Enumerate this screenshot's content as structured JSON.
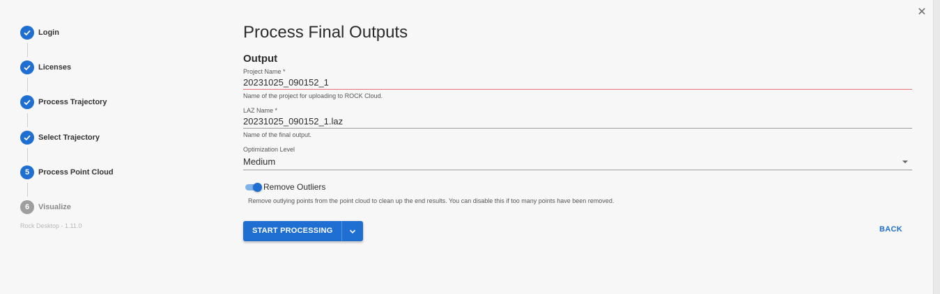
{
  "stepper": {
    "steps": [
      {
        "label": "Login",
        "status": "done",
        "marker": ""
      },
      {
        "label": "Licenses",
        "status": "done",
        "marker": ""
      },
      {
        "label": "Process Trajectory",
        "status": "done",
        "marker": ""
      },
      {
        "label": "Select Trajectory",
        "status": "done",
        "marker": ""
      },
      {
        "label": "Process Point Cloud",
        "status": "active",
        "marker": "5"
      },
      {
        "label": "Visualize",
        "status": "inactive",
        "marker": "6"
      }
    ],
    "version": "Rock Desktop - 1.11.0"
  },
  "main": {
    "title": "Process Final Outputs",
    "section": "Output",
    "project_name": {
      "label": "Project Name *",
      "value": "20231025_090152_1",
      "helper": "Name of the project for uploading to ROCK Cloud."
    },
    "laz_name": {
      "label": "LAZ Name *",
      "value": "20231025_090152_1.laz",
      "helper": "Name of the final output."
    },
    "optimization": {
      "label": "Optimization Level",
      "value": "Medium"
    },
    "remove_outliers": {
      "label": "Remove Outliers",
      "enabled": true,
      "helper": "Remove outlying points from the point cloud to clean up the end results. You can disable this if too many points have been removed."
    },
    "start_button": "START PROCESSING",
    "back_button": "BACK"
  },
  "close_symbol": "✕",
  "colors": {
    "accent": "#1e6fd1",
    "inactive": "#9e9e9e",
    "error_underline": "#e57373",
    "background": "#f7f7f7"
  }
}
